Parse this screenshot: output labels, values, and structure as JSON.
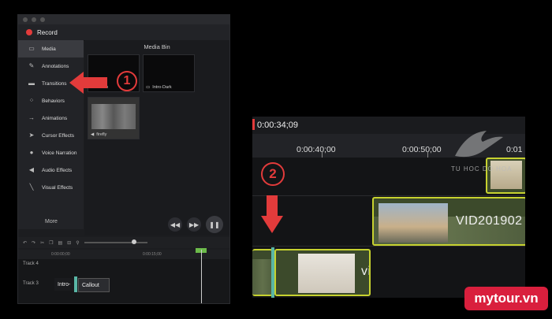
{
  "left_app": {
    "record_label": "Record",
    "sidebar": [
      {
        "label": "Media",
        "icon": "film-icon"
      },
      {
        "label": "Annotations",
        "icon": "annotation-icon"
      },
      {
        "label": "Transitions",
        "icon": "transition-icon"
      },
      {
        "label": "Behaviors",
        "icon": "behavior-icon"
      },
      {
        "label": "Animations",
        "icon": "animation-icon"
      },
      {
        "label": "Cursor Effects",
        "icon": "cursor-icon"
      },
      {
        "label": "Voice Narration",
        "icon": "microphone-icon"
      },
      {
        "label": "Audio Effects",
        "icon": "speaker-icon"
      },
      {
        "label": "Visual Effects",
        "icon": "wand-icon"
      }
    ],
    "more_label": "More",
    "media_bin_title": "Media Bin",
    "media_items": [
      "Video",
      "Intro-Dark",
      "firefly"
    ],
    "ruler_times": [
      "0:00:00;00",
      "0:00:15;00"
    ],
    "track_labels": [
      "Track 4",
      "Track 3"
    ],
    "clips": [
      "Intro-",
      "Callout"
    ]
  },
  "right_zoom": {
    "timecode": "0:00:34;09",
    "ticks": [
      "0:00:40;00",
      "0:00:50;00",
      "0:01"
    ],
    "clip_label": "VID201902",
    "clip_label_2": "vi"
  },
  "badges": [
    "1",
    "2"
  ],
  "watermark": "TU HOC DO HOA",
  "brand": "mytour.vn",
  "colors": {
    "accent_red": "#e23b3b",
    "clip_border": "#c7d22f",
    "brand_bg": "#d91f3d"
  }
}
